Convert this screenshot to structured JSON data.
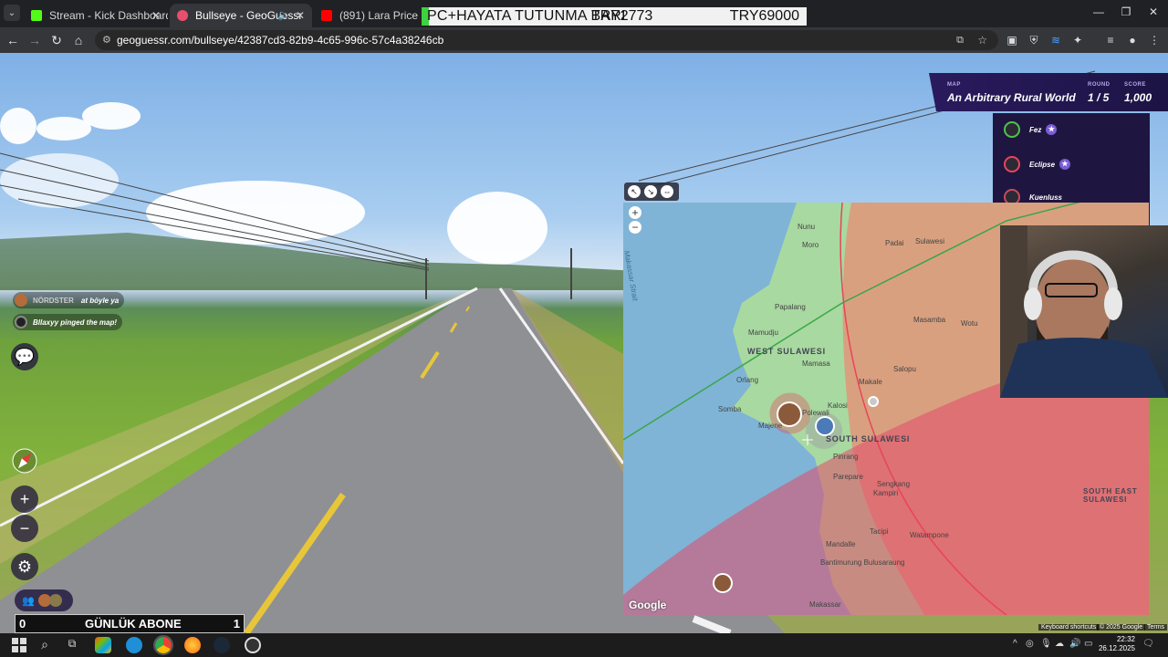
{
  "browser": {
    "tabs": [
      {
        "title": "Stream - Kick Dashboard",
        "favicon_color": "#53fc18",
        "active": false
      },
      {
        "title": "Bullseye - GeoGuessr",
        "favicon_color": "#e84f6f",
        "active": true
      },
      {
        "title": "(891) Lara Price - Crazy - Yo",
        "favicon_color": "#ff0000",
        "active": false
      }
    ],
    "url": "geoguessr.com/bullseye/42387cd3-82b9-4c65-996c-57c4a38246cb"
  },
  "overlay": {
    "text1": "PC+HAYATA TUTUNMA BARI",
    "text2": "TRY2773",
    "text3": "TRY69000"
  },
  "chat": [
    {
      "name": "NÖRDSTER",
      "message": "at böyle ya"
    },
    {
      "name": "",
      "message": "Bllaxyy pinged the map!"
    }
  ],
  "hud": {
    "map_label": "MAP",
    "map_name": "An Arbitrary Rural World",
    "round_label": "ROUND",
    "round_value": "1 / 5",
    "score_label": "SCORE",
    "score_value": "1,000"
  },
  "players": [
    {
      "name": "Fez",
      "ring_color": "#4fc24f",
      "badge": "★"
    },
    {
      "name": "Eclipse",
      "ring_color": "#e8445a",
      "badge": "★"
    },
    {
      "name": "Kuenluss",
      "ring_color": "#c94a5a",
      "badge": ""
    }
  ],
  "map": {
    "labels": [
      "Nunu",
      "Moro",
      "Padai",
      "Sulawesi",
      "Papalang",
      "Mamudju",
      "Masamba",
      "Wotu",
      "WEST SULAWESI",
      "Mamasa",
      "Salopu",
      "Makale",
      "Orlang",
      "Kalosi",
      "Somba",
      "Majene",
      "Polewali",
      "SOUTH SULAWESI",
      "Pinrang",
      "Parepare",
      "Sengkang",
      "Kampiri",
      "Tacipi",
      "Watampone",
      "Mandalle",
      "Bantimurung Bulusaraung",
      "Makassar",
      "SOUTH EAST SULAWESI",
      "Makassar Strait"
    ],
    "google": "Google",
    "keyboard_shortcuts": "Keyboard shortcuts",
    "copyright": "© 2025 Google",
    "terms": "Terms"
  },
  "street_view": {
    "abone_left": "0",
    "abone_label": "GÜNLÜK ABONE",
    "abone_right": "1"
  },
  "taskbar": {
    "time": "22:32",
    "date": "26.12.2025"
  },
  "colors": {
    "hud_bg": "#2a1a5e",
    "circle_red": "#e8445a",
    "circle_green": "#3aa648"
  }
}
